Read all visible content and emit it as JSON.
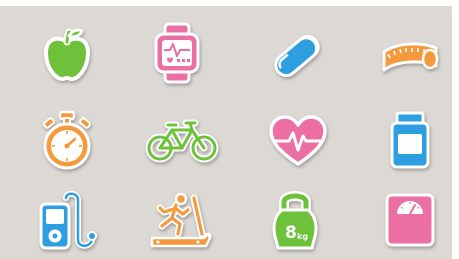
{
  "colors": {
    "background": "#dcd8d4",
    "green": "#6ec13a",
    "pink": "#ec6fa3",
    "blue": "#2d9fe0",
    "orange": "#f59a3c",
    "outline": "#ffffff"
  },
  "icons": [
    {
      "name": "apple-icon",
      "color": "#6ec13a"
    },
    {
      "name": "smartwatch-icon",
      "color": "#ec6fa3"
    },
    {
      "name": "pill-capsule-icon",
      "color": "#2d9fe0"
    },
    {
      "name": "measuring-tape-icon",
      "color": "#f59a3c"
    },
    {
      "name": "stopwatch-icon",
      "color": "#f59a3c"
    },
    {
      "name": "bicycle-icon",
      "color": "#6ec13a"
    },
    {
      "name": "heartbeat-icon",
      "color": "#ec6fa3"
    },
    {
      "name": "supplement-jar-icon",
      "color": "#2d9fe0"
    },
    {
      "name": "mp3-player-icon",
      "color": "#2d9fe0"
    },
    {
      "name": "treadmill-icon",
      "color": "#f59a3c"
    },
    {
      "name": "kettlebell-icon",
      "color": "#6ec13a"
    },
    {
      "name": "bathroom-scale-icon",
      "color": "#ec6fa3"
    }
  ],
  "kettlebell_label": "8",
  "kettlebell_unit": "kg"
}
